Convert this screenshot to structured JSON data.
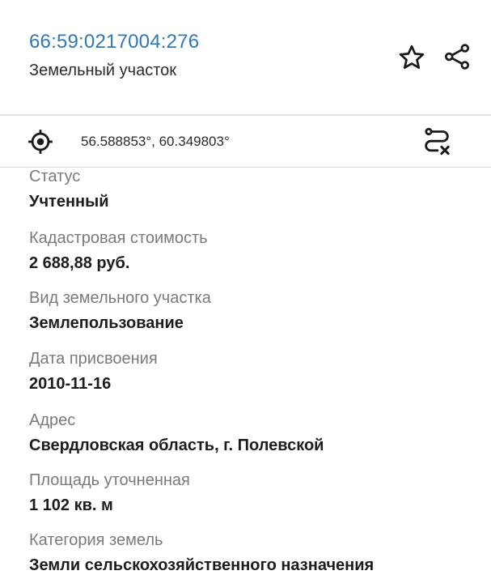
{
  "header": {
    "cadastral_number": "66:59:0217004:276",
    "object_type": "Земельный участок",
    "star_icon": "star-outline-icon",
    "share_icon": "share-icon"
  },
  "coords_bar": {
    "coordinates": "56.588853°, 60.349803°",
    "locate_icon": "crosshair-target-icon",
    "route_icon": "route-cancel-icon"
  },
  "fields": [
    {
      "label": "Статус",
      "value": "Учтенный"
    },
    {
      "label": "Кадастровая стоимость",
      "value": "2 688,88 руб."
    },
    {
      "label": "Вид земельного участка",
      "value": "Землепользование"
    },
    {
      "label": "Дата присвоения",
      "value": "2010-11-16"
    },
    {
      "label": "Адрес",
      "value": "Свердловская область, г. Полевской"
    },
    {
      "label": "Площадь уточненная",
      "value": "1 102 кв. м"
    },
    {
      "label": "Категория земель",
      "value": "Земли сельскохозяйственного назначения"
    }
  ],
  "colors": {
    "link_blue": "#2f78b5",
    "label_gray": "#7a7a7a",
    "value_dark": "#1c1c1c"
  }
}
